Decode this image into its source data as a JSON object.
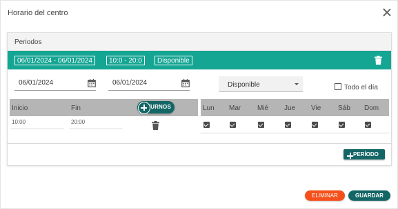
{
  "dialog": {
    "title": "Horario del centro",
    "close_icon": "close-icon"
  },
  "periods": {
    "header": "Periodos",
    "summary": {
      "date_range": "06/01/2024 - 06/01/2024",
      "time_range": "10:0 - 20:0",
      "status": "Disponible",
      "delete_icon": "trash-icon"
    },
    "editor": {
      "start_date": "06/01/2024",
      "end_date": "06/01/2024",
      "calendar_icon": "calendar-icon",
      "availability": "Disponible",
      "all_day_label": "Todo el día",
      "all_day_checked": false
    },
    "shifts": {
      "headers": {
        "start": "Inicio",
        "end": "Fin"
      },
      "add_label": "TURNOS",
      "rows": [
        {
          "start": "10:00",
          "end": "20:00"
        }
      ]
    },
    "days": {
      "labels": [
        "Lun",
        "Mar",
        "Mié",
        "Jue",
        "Vie",
        "Sáb",
        "Dom"
      ],
      "checked": [
        true,
        true,
        true,
        true,
        true,
        true,
        true
      ]
    },
    "add_period_label": "PERÍODO"
  },
  "footer": {
    "delete_label": "ELIMINAR",
    "save_label": "GUARDAR"
  },
  "colors": {
    "teal_bar": "#14a593",
    "dark_teal": "#136665",
    "delete_orange": "#f5501b",
    "table_header": "#b5b5b5"
  }
}
